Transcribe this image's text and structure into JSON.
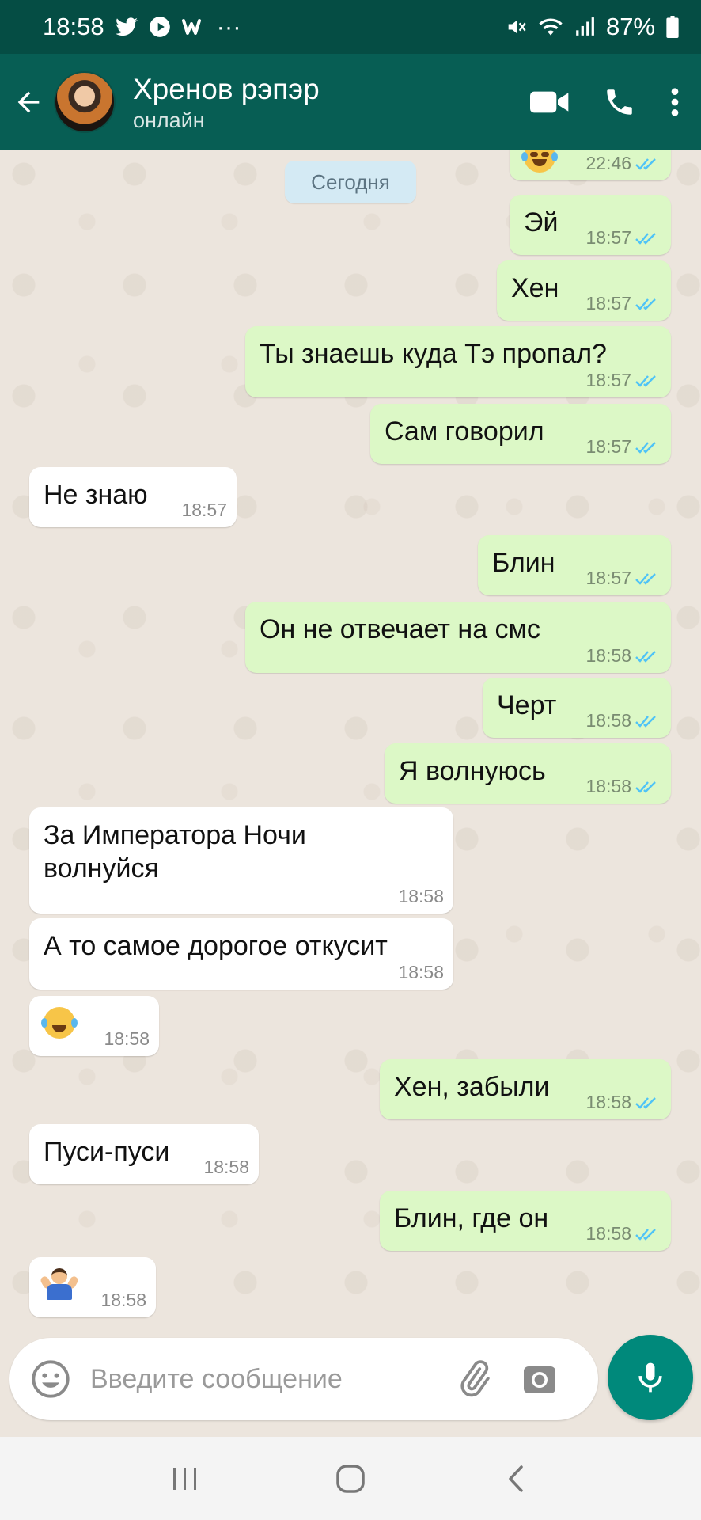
{
  "status_bar": {
    "time": "18:58",
    "more": "···",
    "battery": "87%"
  },
  "header": {
    "contact_name": "Хренов рэпэр",
    "contact_status": "онлайн"
  },
  "date_chip": "Сегодня",
  "messages": [
    {
      "dir": "out",
      "text": "",
      "emoji": "crying-face",
      "time": "22:46",
      "read": true
    },
    {
      "dir": "out",
      "text": "Эй",
      "time": "18:57",
      "read": true
    },
    {
      "dir": "out",
      "text": "Хен",
      "time": "18:57",
      "read": true
    },
    {
      "dir": "out",
      "text": "Ты знаешь куда Тэ пропал?",
      "time": "18:57",
      "read": true
    },
    {
      "dir": "out",
      "text": "Сам говорил",
      "time": "18:57",
      "read": true
    },
    {
      "dir": "in",
      "text": "Не знаю",
      "time": "18:57"
    },
    {
      "dir": "out",
      "text": "Блин",
      "time": "18:57",
      "read": true
    },
    {
      "dir": "out",
      "text": "Он не отвечает на смс",
      "time": "18:58",
      "read": true
    },
    {
      "dir": "out",
      "text": "Черт",
      "time": "18:58",
      "read": true
    },
    {
      "dir": "out",
      "text": "Я волнуюсь",
      "time": "18:58",
      "read": true
    },
    {
      "dir": "in",
      "text": "За Императора Ночи волнуйся",
      "time": "18:58"
    },
    {
      "dir": "in",
      "text": "А то самое дорогое откусит",
      "time": "18:58"
    },
    {
      "dir": "in",
      "text": "",
      "emoji": "tears-of-joy",
      "time": "18:58"
    },
    {
      "dir": "out",
      "text": "Хен, забыли",
      "time": "18:58",
      "read": true
    },
    {
      "dir": "in",
      "text": "Пуси-пуси",
      "time": "18:58"
    },
    {
      "dir": "out",
      "text": "Блин, где он",
      "time": "18:58",
      "read": true
    },
    {
      "dir": "in",
      "text": "",
      "emoji": "person-shrugging",
      "time": "18:58"
    }
  ],
  "input": {
    "placeholder": "Введите сообщение",
    "value": ""
  },
  "colors": {
    "status_bar": "#054d44",
    "app_bar": "#075e54",
    "outgoing_bubble": "#dcf8c6",
    "incoming_bubble": "#ffffff",
    "read_ticks": "#4fc3f7",
    "mic_button": "#00897b"
  },
  "icons": {
    "status": [
      "twitter-icon",
      "youtube-icon",
      "wattpad-icon",
      "mute-icon",
      "wifi-icon",
      "signal-icon",
      "battery-icon"
    ],
    "header": [
      "back-arrow-icon",
      "video-call-icon",
      "phone-icon",
      "more-vert-icon"
    ],
    "input": [
      "emoji-icon",
      "attach-icon",
      "camera-icon",
      "mic-icon"
    ],
    "nav": [
      "recents-icon",
      "home-icon",
      "back-icon"
    ]
  }
}
